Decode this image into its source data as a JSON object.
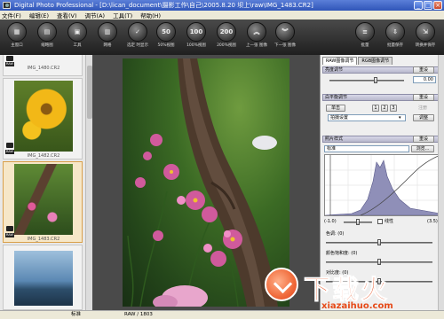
{
  "window": {
    "title": "Digital Photo Professional - [D:\\lican_document\\摄影工作\\自己\\2005.8.20 坝上\\raw\\IMG_1483.CR2]",
    "controls": [
      "_",
      "□",
      "×"
    ]
  },
  "menu": [
    "文件(F)",
    "编辑(E)",
    "查看(V)",
    "调节(A)",
    "工具(T)",
    "帮助(H)"
  ],
  "toolbar": [
    {
      "label": "主窗口",
      "icon": "main-window-icon"
    },
    {
      "label": "缩略图",
      "icon": "thumbnail-icon"
    },
    {
      "label": "工具",
      "icon": "tools-icon"
    },
    {
      "label": "网格",
      "icon": "grid-icon"
    },
    {
      "label": "选定 时显示",
      "icon": "checkmark-icon"
    },
    {
      "label": "50%视图",
      "glyph": "50"
    },
    {
      "label": "100%视图",
      "glyph": "100"
    },
    {
      "label": "200%视图",
      "glyph": "200"
    },
    {
      "label": "上一张 图像",
      "icon": "up-arrow-icon"
    },
    {
      "label": "下一张 图像",
      "icon": "down-arrow-icon"
    },
    {
      "label": "批量",
      "icon": "batch-icon"
    },
    {
      "label": "批量保存",
      "icon": "batch-save-icon"
    },
    {
      "label": "转换并保存",
      "icon": "convert-save-icon"
    }
  ],
  "thumbnails": [
    {
      "caption": "IMG_1480.CR2",
      "raw": "RAW"
    },
    {
      "caption": "IMG_1482.CR2",
      "raw": "RAW"
    },
    {
      "caption": "IMG_1483.CR2",
      "raw": "RAW",
      "selected": true
    },
    {
      "caption": "",
      "raw": ""
    }
  ],
  "right_panel": {
    "tabs": [
      "RAW图像调节",
      "RGB图像调节"
    ],
    "brightness": {
      "label": "亮度调节",
      "button": "重设",
      "value": "0.00"
    },
    "white_balance": {
      "label": "白平衡调节",
      "button": "重设",
      "mode_btn": "单击",
      "steps": [
        "1",
        "2",
        "3"
      ],
      "register": "注册",
      "preset": "拍摄设置",
      "adjust_btn": "调整"
    },
    "picture_style": {
      "label": "照片样式",
      "button": "重设",
      "value": "标准",
      "browse": "浏览..."
    },
    "histogram": {
      "left_val": "(-1.0)",
      "linear": "线性",
      "right_val": "(3.5)"
    },
    "sliders": [
      {
        "label": "色调: (0)"
      },
      {
        "label": "颜色饱和度: (0)"
      },
      {
        "label": "对比度: (0)"
      }
    ]
  },
  "status": {
    "left": "标准",
    "mid": "RAW / 1803"
  },
  "watermark": {
    "big": "下载火",
    "small": "xiazaihuo.com"
  }
}
